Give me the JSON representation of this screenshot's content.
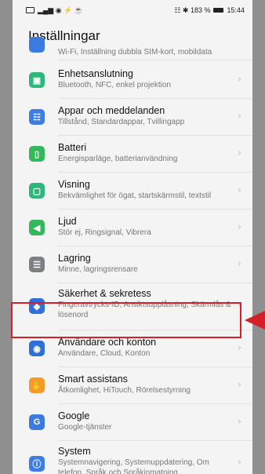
{
  "status": {
    "left_icons": "▂▄▆ ◉ ⚡ ☕",
    "right_text": "☷ ✱ 183 %",
    "time": "15:44"
  },
  "page_title": "Inställningar",
  "items": [
    {
      "key": "trad",
      "title": "",
      "subtitle": "Wi-Fi, Inställning dubbla SIM-kort, mobildata",
      "icon": "signal-icon",
      "color": "#3b7be0",
      "glyph": ""
    },
    {
      "key": "enhet",
      "title": "Enhetsanslutning",
      "subtitle": "Bluetooth, NFC, enkel projektion",
      "icon": "device-connection-icon",
      "color": "#2eb77b",
      "glyph": "▣"
    },
    {
      "key": "appar",
      "title": "Appar och meddelanden",
      "subtitle": "Tillstånd, Standardappar, Tvillingapp",
      "icon": "apps-icon",
      "color": "#3d7ce3",
      "glyph": "☷"
    },
    {
      "key": "batteri",
      "title": "Batteri",
      "subtitle": "Energisparläge, batterianvändning",
      "icon": "battery-icon",
      "color": "#35b85c",
      "glyph": "▯"
    },
    {
      "key": "visning",
      "title": "Visning",
      "subtitle": "Bekvämlighet för ögat, startskärmstil, textstil",
      "icon": "display-icon",
      "color": "#2eb77b",
      "glyph": "▢"
    },
    {
      "key": "ljud",
      "title": "Ljud",
      "subtitle": "Stör ej, Ringsignal, Vibrera",
      "icon": "sound-icon",
      "color": "#35b85c",
      "glyph": "◀"
    },
    {
      "key": "lagring",
      "title": "Lagring",
      "subtitle": "Minne, lagringsrensare",
      "icon": "storage-icon",
      "color": "#7c8085",
      "glyph": "☰"
    },
    {
      "key": "sakerhet",
      "title": "Säkerhet & sekretess",
      "subtitle": "Fingeravtrycks-ID, Ansiktsupplåsning, Skärmlås & lösenord",
      "icon": "shield-icon",
      "color": "#2f6fd6",
      "glyph": "◆"
    },
    {
      "key": "anvandare",
      "title": "Användare och konton",
      "subtitle": "Användare, Cloud, Konton",
      "icon": "user-icon",
      "color": "#2f6fd6",
      "glyph": "◉"
    },
    {
      "key": "smart",
      "title": "Smart assistans",
      "subtitle": "Åtkomlighet, HiTouch, Rörelsestyrning",
      "icon": "hand-icon",
      "color": "#f39a2b",
      "glyph": "✋"
    },
    {
      "key": "google",
      "title": "Google",
      "subtitle": "Google-tjänster",
      "icon": "google-icon",
      "color": "#3b7be0",
      "glyph": "G"
    },
    {
      "key": "system",
      "title": "System",
      "subtitle": "Systemnavigering, Systemuppdatering, Om telefon, Språk och Språkinmatning",
      "icon": "system-icon",
      "color": "#3d7ce3",
      "glyph": "ⓘ"
    }
  ],
  "chevron": "›"
}
